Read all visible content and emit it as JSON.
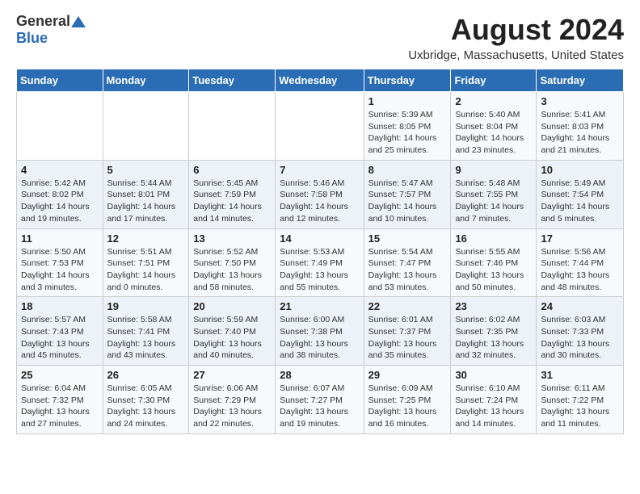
{
  "header": {
    "logo_general": "General",
    "logo_blue": "Blue",
    "title": "August 2024",
    "subtitle": "Uxbridge, Massachusetts, United States"
  },
  "calendar": {
    "days_of_week": [
      "Sunday",
      "Monday",
      "Tuesday",
      "Wednesday",
      "Thursday",
      "Friday",
      "Saturday"
    ],
    "weeks": [
      [
        {
          "day": "",
          "info": ""
        },
        {
          "day": "",
          "info": ""
        },
        {
          "day": "",
          "info": ""
        },
        {
          "day": "",
          "info": ""
        },
        {
          "day": "1",
          "info": "Sunrise: 5:39 AM\nSunset: 8:05 PM\nDaylight: 14 hours\nand 25 minutes."
        },
        {
          "day": "2",
          "info": "Sunrise: 5:40 AM\nSunset: 8:04 PM\nDaylight: 14 hours\nand 23 minutes."
        },
        {
          "day": "3",
          "info": "Sunrise: 5:41 AM\nSunset: 8:03 PM\nDaylight: 14 hours\nand 21 minutes."
        }
      ],
      [
        {
          "day": "4",
          "info": "Sunrise: 5:42 AM\nSunset: 8:02 PM\nDaylight: 14 hours\nand 19 minutes."
        },
        {
          "day": "5",
          "info": "Sunrise: 5:44 AM\nSunset: 8:01 PM\nDaylight: 14 hours\nand 17 minutes."
        },
        {
          "day": "6",
          "info": "Sunrise: 5:45 AM\nSunset: 7:59 PM\nDaylight: 14 hours\nand 14 minutes."
        },
        {
          "day": "7",
          "info": "Sunrise: 5:46 AM\nSunset: 7:58 PM\nDaylight: 14 hours\nand 12 minutes."
        },
        {
          "day": "8",
          "info": "Sunrise: 5:47 AM\nSunset: 7:57 PM\nDaylight: 14 hours\nand 10 minutes."
        },
        {
          "day": "9",
          "info": "Sunrise: 5:48 AM\nSunset: 7:55 PM\nDaylight: 14 hours\nand 7 minutes."
        },
        {
          "day": "10",
          "info": "Sunrise: 5:49 AM\nSunset: 7:54 PM\nDaylight: 14 hours\nand 5 minutes."
        }
      ],
      [
        {
          "day": "11",
          "info": "Sunrise: 5:50 AM\nSunset: 7:53 PM\nDaylight: 14 hours\nand 3 minutes."
        },
        {
          "day": "12",
          "info": "Sunrise: 5:51 AM\nSunset: 7:51 PM\nDaylight: 14 hours\nand 0 minutes."
        },
        {
          "day": "13",
          "info": "Sunrise: 5:52 AM\nSunset: 7:50 PM\nDaylight: 13 hours\nand 58 minutes."
        },
        {
          "day": "14",
          "info": "Sunrise: 5:53 AM\nSunset: 7:49 PM\nDaylight: 13 hours\nand 55 minutes."
        },
        {
          "day": "15",
          "info": "Sunrise: 5:54 AM\nSunset: 7:47 PM\nDaylight: 13 hours\nand 53 minutes."
        },
        {
          "day": "16",
          "info": "Sunrise: 5:55 AM\nSunset: 7:46 PM\nDaylight: 13 hours\nand 50 minutes."
        },
        {
          "day": "17",
          "info": "Sunrise: 5:56 AM\nSunset: 7:44 PM\nDaylight: 13 hours\nand 48 minutes."
        }
      ],
      [
        {
          "day": "18",
          "info": "Sunrise: 5:57 AM\nSunset: 7:43 PM\nDaylight: 13 hours\nand 45 minutes."
        },
        {
          "day": "19",
          "info": "Sunrise: 5:58 AM\nSunset: 7:41 PM\nDaylight: 13 hours\nand 43 minutes."
        },
        {
          "day": "20",
          "info": "Sunrise: 5:59 AM\nSunset: 7:40 PM\nDaylight: 13 hours\nand 40 minutes."
        },
        {
          "day": "21",
          "info": "Sunrise: 6:00 AM\nSunset: 7:38 PM\nDaylight: 13 hours\nand 38 minutes."
        },
        {
          "day": "22",
          "info": "Sunrise: 6:01 AM\nSunset: 7:37 PM\nDaylight: 13 hours\nand 35 minutes."
        },
        {
          "day": "23",
          "info": "Sunrise: 6:02 AM\nSunset: 7:35 PM\nDaylight: 13 hours\nand 32 minutes."
        },
        {
          "day": "24",
          "info": "Sunrise: 6:03 AM\nSunset: 7:33 PM\nDaylight: 13 hours\nand 30 minutes."
        }
      ],
      [
        {
          "day": "25",
          "info": "Sunrise: 6:04 AM\nSunset: 7:32 PM\nDaylight: 13 hours\nand 27 minutes."
        },
        {
          "day": "26",
          "info": "Sunrise: 6:05 AM\nSunset: 7:30 PM\nDaylight: 13 hours\nand 24 minutes."
        },
        {
          "day": "27",
          "info": "Sunrise: 6:06 AM\nSunset: 7:29 PM\nDaylight: 13 hours\nand 22 minutes."
        },
        {
          "day": "28",
          "info": "Sunrise: 6:07 AM\nSunset: 7:27 PM\nDaylight: 13 hours\nand 19 minutes."
        },
        {
          "day": "29",
          "info": "Sunrise: 6:09 AM\nSunset: 7:25 PM\nDaylight: 13 hours\nand 16 minutes."
        },
        {
          "day": "30",
          "info": "Sunrise: 6:10 AM\nSunset: 7:24 PM\nDaylight: 13 hours\nand 14 minutes."
        },
        {
          "day": "31",
          "info": "Sunrise: 6:11 AM\nSunset: 7:22 PM\nDaylight: 13 hours\nand 11 minutes."
        }
      ]
    ]
  }
}
